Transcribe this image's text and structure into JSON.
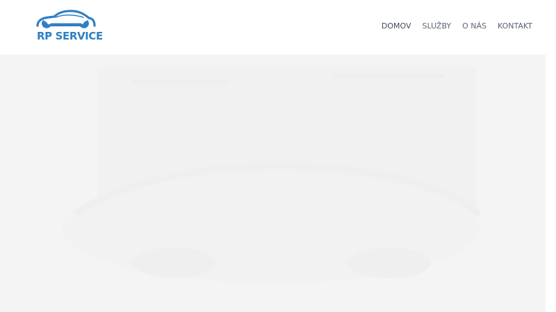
{
  "brand": {
    "name": "RP SERVICE",
    "color": "#2f7fc3"
  },
  "nav": {
    "items": [
      {
        "label": "DOMOV",
        "active": true
      },
      {
        "label": "SLUŽBY",
        "active": false
      },
      {
        "label": "O NÁS",
        "active": false
      },
      {
        "label": "KONTAKT",
        "active": false
      }
    ]
  },
  "hero": {
    "background_color": "#f4f4f4",
    "image": "faded-car-service-photo"
  }
}
